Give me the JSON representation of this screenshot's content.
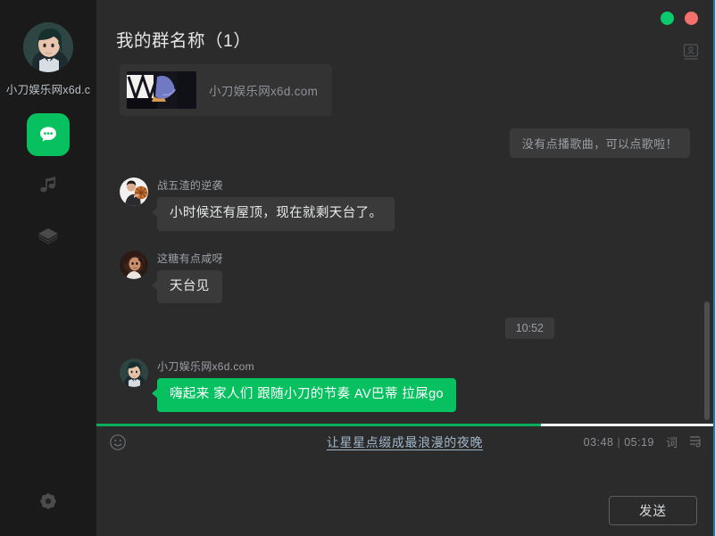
{
  "colors": {
    "accent_green": "#07c160",
    "progress_green": "#09ad5b",
    "window_green_dot": "#0ccb6c",
    "window_red_dot": "#f4706c",
    "panel_bg": "#2b2b2b",
    "sidebar_bg": "#1a1a1a",
    "bubble_gray": "#3a3a3a",
    "link_blue": "#9fb6c9",
    "border_teal": "#2d7a9e"
  },
  "sidebar": {
    "user_name": "小刀娱乐网x6d.c",
    "avatar_icon": "user-avatar-anime",
    "items": [
      {
        "id": "chat",
        "icon": "chat-bubble-icon",
        "label": "聊天",
        "active": true
      },
      {
        "id": "music",
        "icon": "music-note-icon",
        "label": "音乐",
        "active": false
      },
      {
        "id": "layers",
        "icon": "layers-icon",
        "label": "图层",
        "active": false
      }
    ],
    "settings": {
      "icon": "gear-icon",
      "label": "设置"
    }
  },
  "header": {
    "title": "我的群名称（1）",
    "contacts_icon": "contact-card-icon",
    "window_buttons": [
      {
        "id": "minimize",
        "name": "green-dot-button",
        "color": "#0ccb6c"
      },
      {
        "id": "close",
        "name": "red-dot-button",
        "color": "#f4706c"
      }
    ]
  },
  "messages": [
    {
      "type": "card",
      "align": "left",
      "thumbnail": "video-thumbnail",
      "text": "小刀娱乐网x6d.com"
    },
    {
      "type": "system",
      "align": "right",
      "text": "没有点播歌曲，可以点歌啦！"
    },
    {
      "type": "text",
      "align": "left",
      "sender": "战五渣的逆袭",
      "avatar": "avatar-basketball-player",
      "text": "小时候还有屋顶，现在就剩天台了。",
      "green": false
    },
    {
      "type": "text",
      "align": "left",
      "sender": "这糖有点咸呀",
      "avatar": "avatar-curly-hair-woman",
      "text": "天台见",
      "green": false
    },
    {
      "type": "timestamp",
      "align": "right",
      "text": "10:52"
    },
    {
      "type": "text",
      "align": "left",
      "sender": "小刀娱乐网x6d.com",
      "avatar": "avatar-anime-character",
      "text": "嗨起来 家人们 跟随小刀的节奏 AV巴蒂 拉屎go",
      "green": true
    }
  ],
  "player": {
    "emoji_icon": "smiley-face-icon",
    "song_title": "让星星点缀成最浪漫的夜晚",
    "elapsed": "03:48",
    "separator": "|",
    "duration": "05:19",
    "lyrics_label": "词",
    "playlist_icon": "playlist-icon",
    "progress_percent": 72
  },
  "compose": {
    "value": "",
    "placeholder": "",
    "send_label": "发送"
  },
  "scrollbar": {
    "thumb_top_percent": 66,
    "thumb_height_percent": 33
  }
}
